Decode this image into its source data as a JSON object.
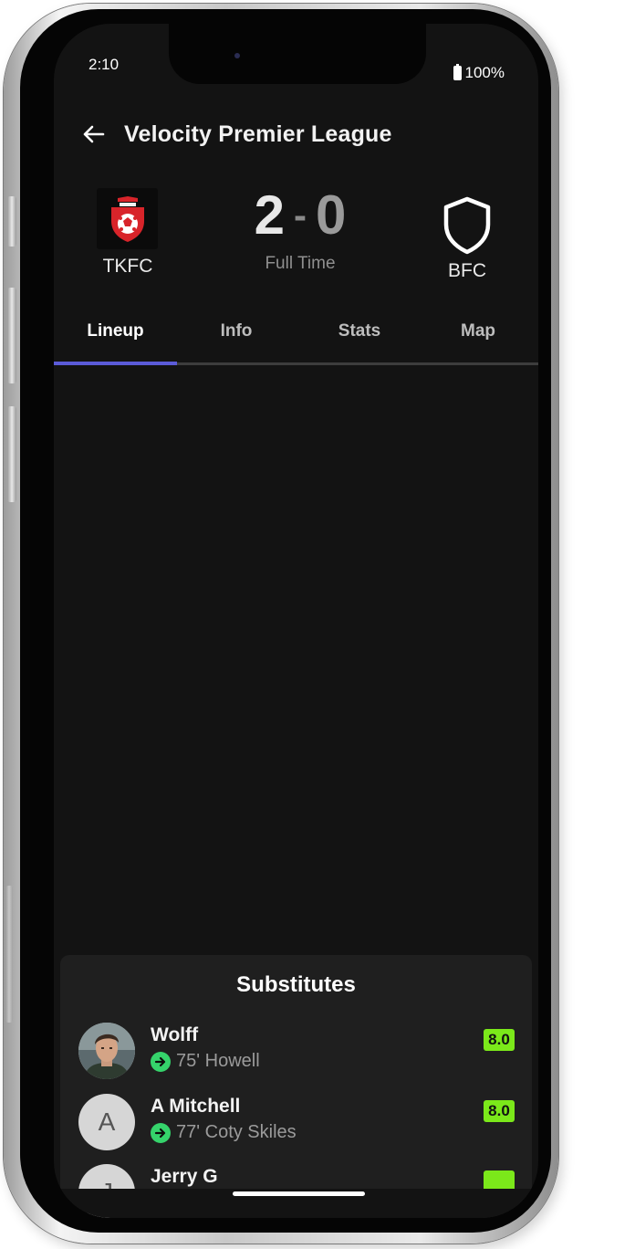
{
  "status_bar": {
    "time": "2:10",
    "battery": "100%"
  },
  "header": {
    "back_icon": "arrow-left-icon",
    "title": "Velocity Premier League"
  },
  "match": {
    "home_team": "TKFC",
    "home_score": "2",
    "separator": "-",
    "away_score": "0",
    "away_team": "BFC",
    "status": "Full Time"
  },
  "tabs": [
    {
      "label": "Lineup",
      "active": true
    },
    {
      "label": "Info",
      "active": false
    },
    {
      "label": "Stats",
      "active": false
    },
    {
      "label": "Map",
      "active": false
    }
  ],
  "substitutes": {
    "title": "Substitutes",
    "players": [
      {
        "name": "Wolff",
        "detail": "75' Howell",
        "rating": "8.0",
        "avatar": "photo"
      },
      {
        "name": "A Mitchell",
        "detail": "77' Coty Skiles",
        "rating": "8.0",
        "avatar_letter": "A"
      },
      {
        "name": "Jerry G",
        "detail": "",
        "rating": "",
        "avatar_letter": "J"
      }
    ]
  },
  "colors": {
    "background": "#131313",
    "accent": "#5b5bd8",
    "rating": "#7be81a",
    "sub_in": "#35d36b",
    "home_crest": "#d8242a"
  }
}
